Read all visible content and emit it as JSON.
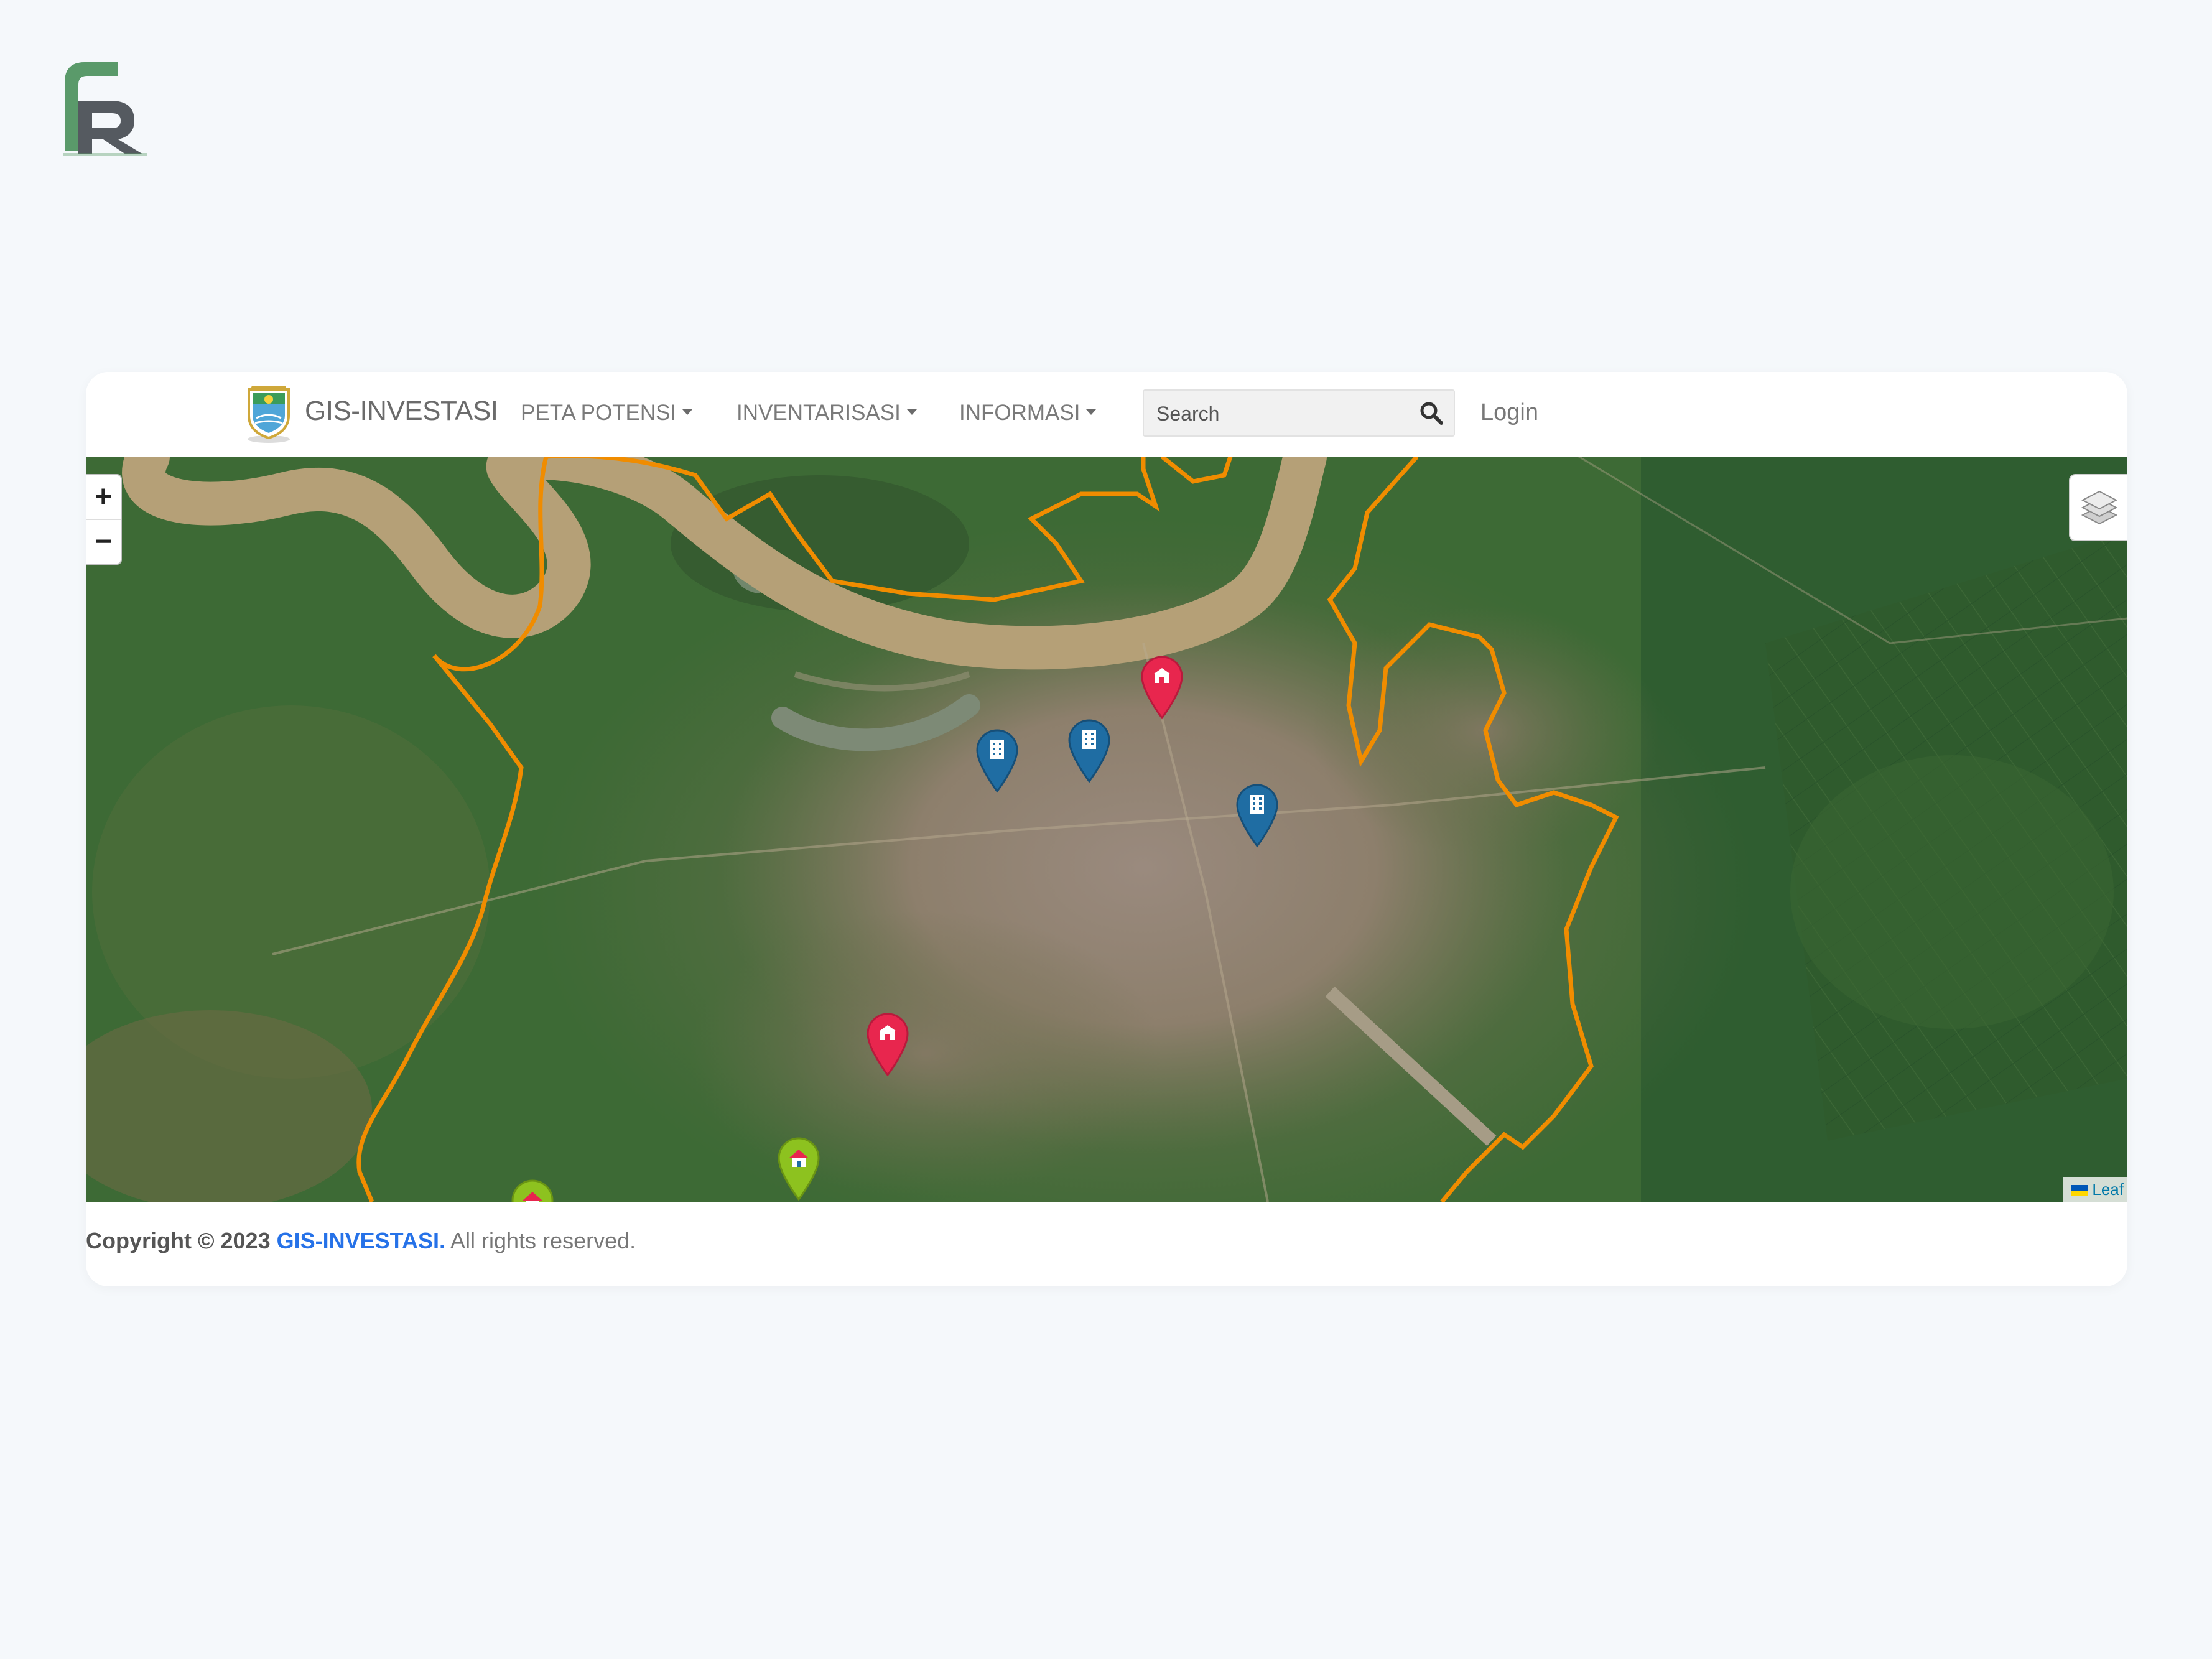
{
  "navbar": {
    "brand": "GIS-INVESTASI",
    "menu": [
      {
        "label": "PETA POTENSI"
      },
      {
        "label": "INVENTARISASI"
      },
      {
        "label": "INFORMASI"
      }
    ],
    "search_placeholder": "Search",
    "login_label": "Login"
  },
  "map": {
    "zoom_in_label": "+",
    "zoom_out_label": "−",
    "attribution": "Leaf",
    "markers": [
      {
        "type": "government-building",
        "color": "#e8264e"
      },
      {
        "type": "office-building",
        "color": "#1f6da3"
      },
      {
        "type": "office-building",
        "color": "#1f6da3"
      },
      {
        "type": "office-building",
        "color": "#1f6da3"
      },
      {
        "type": "government-building",
        "color": "#e8264e"
      },
      {
        "type": "housing",
        "color": "#8dc21f"
      },
      {
        "type": "housing",
        "color": "#8dc21f"
      }
    ],
    "boundary_color": "#f08c00"
  },
  "footer": {
    "copyright_prefix": "Copyright © 2023",
    "site_name": "GIS-INVESTASI.",
    "rights": "All rights reserved."
  }
}
